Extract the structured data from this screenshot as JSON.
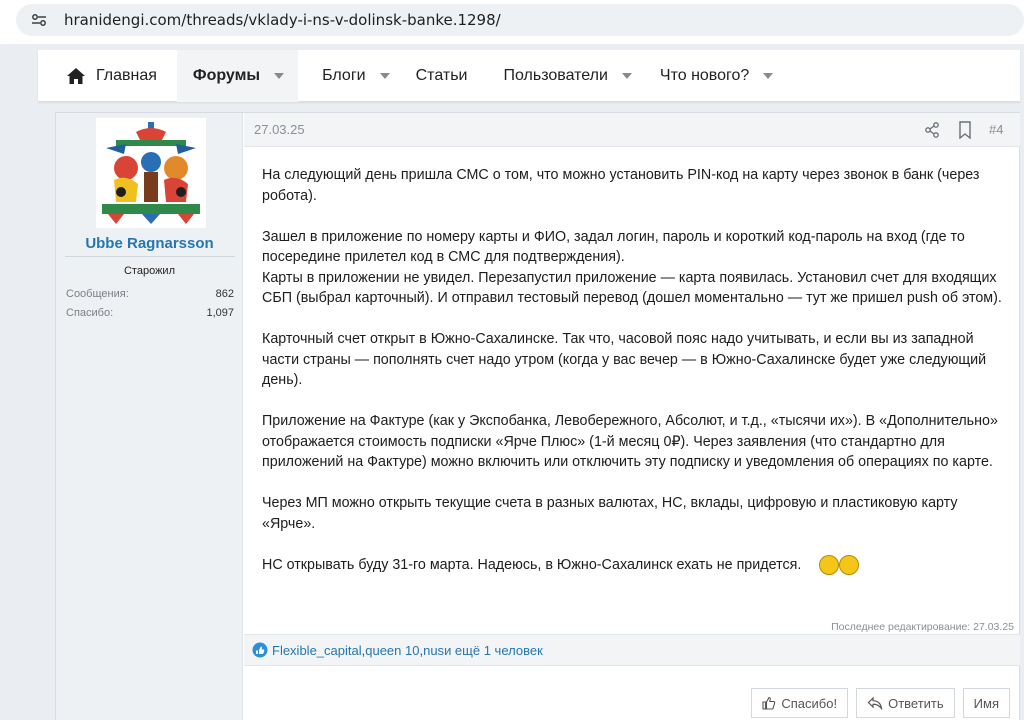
{
  "browser": {
    "url": "hranidengi.com/threads/vklady-i-ns-v-dolinsk-banke.1298/"
  },
  "nav": {
    "items": [
      {
        "label": "Главная",
        "icon": "home-icon",
        "active": false
      },
      {
        "label": "Форумы",
        "active": true,
        "caret": true
      },
      {
        "label": "Блоги",
        "caret": true
      },
      {
        "label": "Статьи"
      },
      {
        "label": "Пользователи",
        "caret": true
      },
      {
        "label": "Что нового?",
        "caret": true
      }
    ]
  },
  "user": {
    "name": "Ubbe Ragnarsson",
    "title": "Старожил",
    "stats": [
      {
        "label": "Сообщения:",
        "value": "862"
      },
      {
        "label": "Спасибо:",
        "value": "1,097"
      }
    ]
  },
  "post": {
    "date": "27.03.25",
    "number": "#4",
    "paragraphs": [
      "На следующий день пришла СМС о том, что можно установить PIN-код на карту через звонок в банк (через робота).",
      "Зашел в приложение по номеру карты и ФИО, задал логин, пароль и короткий код-пароль на вход (где то посередине прилетел код в СМС для подтверждения).",
      "Карты в приложении не увидел. Перезапустил приложение — карта появилась. Установил счет для входящих СБП (выбрал карточный). И отправил тестовый перевод (дошел моментально — тут же пришел push об этом).",
      "Карточный счет открыт в Южно-Сахалинске. Так что, часовой пояс надо учитывать, и если вы из западной части страны — пополнять счет надо утром (когда у вас вечер — в Южно-Сахалинске будет уже следующий день).",
      "Приложение на Фактуре (как у Экспобанка, Левобережного, Абсолют, и т.д., «тысячи их»). В «Дополнительно» отображается стоимость подписки «Ярче Плюс» (1-й месяц 0₽). Через заявления (что стандартно для приложений на Фактуре) можно включить или отключить эту подписку и уведомления об операциях по карте.",
      "Через МП можно открыть текущие счета в разных валютах, НС, вклады, цифровую и пластиковую карту «Ярче».",
      "НС открывать буду 31-го марта. Надеюсь, в Южно-Сахалинск ехать не придется."
    ],
    "edited": "Последнее редактирование: 27.03.25",
    "reactions": {
      "users": [
        "Flexible_capital",
        "queen 10",
        "nus"
      ],
      "separator": ", ",
      "and_more": " и ещё 1 человек"
    },
    "actions": {
      "thanks": "Спасибо!",
      "reply": "Ответить",
      "name": "Имя"
    }
  },
  "colors": {
    "link": "#2577b1",
    "pane": "#eef1f4",
    "page_bg": "#eaeef2"
  }
}
